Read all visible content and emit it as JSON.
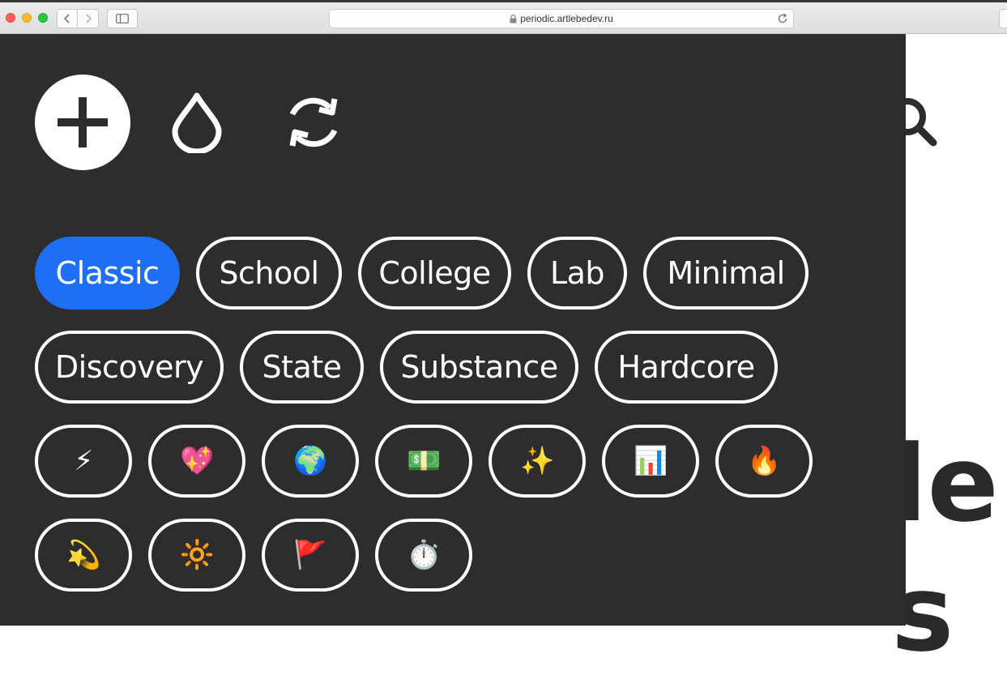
{
  "browser": {
    "url": "periodic.artlebedev.ru"
  },
  "toolbar": {
    "add_icon": "plus-icon",
    "drop_icon": "drop-icon",
    "refresh_icon": "refresh-icon",
    "search_icon": "search-icon"
  },
  "themes": [
    {
      "label": "Classic",
      "active": true
    },
    {
      "label": "School"
    },
    {
      "label": "College"
    },
    {
      "label": "Lab"
    },
    {
      "label": "Minimal"
    },
    {
      "label": "Discovery"
    },
    {
      "label": "State"
    },
    {
      "label": "Substance"
    },
    {
      "label": "Hardcore"
    }
  ],
  "emoji_filters": [
    "⚡",
    "💖",
    "🌍",
    "💵",
    "✨",
    "📊",
    "🔥",
    "💫",
    "🔆",
    "🚩",
    "⏱️"
  ],
  "background_text": {
    "line1": "le",
    "line2": "s"
  },
  "colors": {
    "panel": "#2d2d2d",
    "accent": "#1f6ff5"
  }
}
